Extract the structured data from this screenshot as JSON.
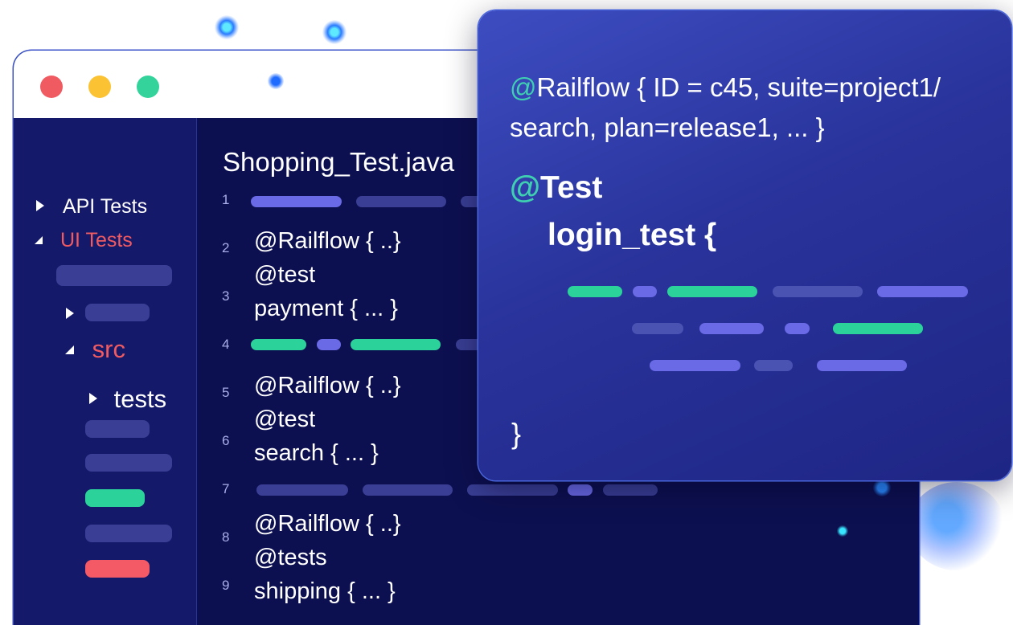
{
  "window_controls": [
    "close",
    "minimize",
    "maximize"
  ],
  "sidebar": {
    "items": [
      {
        "label": "API Tests",
        "expanded": false
      },
      {
        "label": "UI Tests",
        "expanded": true,
        "color": "#f05b62"
      },
      {
        "label": "src",
        "expanded": true,
        "color": "#f05b62"
      },
      {
        "label": "tests",
        "expanded": false
      }
    ]
  },
  "editor": {
    "file_name": "Shopping_Test.java",
    "line_numbers": [
      "1",
      "2",
      "3",
      "4",
      "5",
      "6",
      "7",
      "8",
      "9"
    ],
    "lines": {
      "l2a": "@Railflow { ..}",
      "l2b": "@test",
      "l3": "payment { ... }",
      "l5a": "@Railflow { ..}",
      "l5b": "@test",
      "l6": "search { ... }",
      "l8a": "@Railflow { ..}",
      "l8b": "@tests",
      "l9": "shipping { ... }"
    }
  },
  "popup": {
    "line1_prefix": "@",
    "line1_rest": "Railflow { ID = c45, suite=project1/",
    "line2": "search, plan=release1, ... }",
    "annotation_prefix": "@",
    "annotation": "Test",
    "method": "login_test {",
    "closing": "}"
  },
  "colors": {
    "accent_green": "#2bd39b",
    "accent_red": "#f05b62",
    "indigo": "#6a69e6",
    "editor_bg": "#0d1050",
    "popup_bg": "#29339b"
  }
}
